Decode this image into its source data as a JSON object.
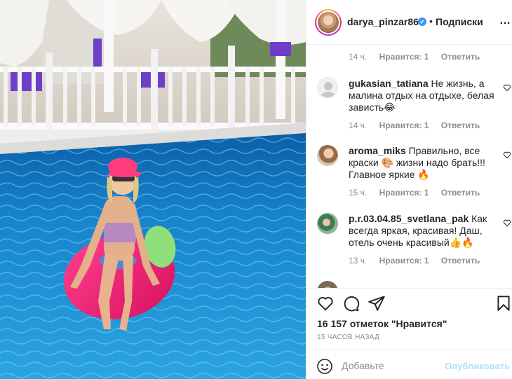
{
  "post": {
    "username": "darya_pinzar86",
    "verified_mark": "✔",
    "separator": "•",
    "follow_label": "Подписки",
    "more_icon": "…"
  },
  "comments": [
    {
      "time": "14 ч.",
      "likes": "Нравится: 1",
      "reply": "Ответить"
    },
    {
      "user": "gukasian_tatiana",
      "text": " Не жизнь, а малина отдых на отдыхе, белая зависть😂",
      "time": "14 ч.",
      "likes": "Нравится: 1",
      "reply": "Ответить"
    },
    {
      "user": "aroma_miks",
      "text": " Правильно, все краски 🎨 жизни надо брать!!! Главное яркие 🔥",
      "time": "15 ч.",
      "likes": "Нравится: 1",
      "reply": "Ответить"
    },
    {
      "user": "p.r.03.04.85_svetlana_pak",
      "text": " Как всегда яркая, красивая! Даш, отель очень красивый👍🔥",
      "time": "13 ч.",
      "likes": "Нравится: 1",
      "reply": "Ответить"
    }
  ],
  "likes_count": "16 157 отметок \"Нравится\"",
  "posted_ago": "15 ЧАСОВ НАЗАД",
  "add_comment": {
    "placeholder": "Добавьте",
    "post_label": "Опубликовать"
  },
  "icons": {
    "like": "heart-icon",
    "comment": "comment-icon",
    "share": "send-icon",
    "save": "bookmark-icon",
    "emoji": "smiley-icon"
  },
  "colors": {
    "link": "#b2dffc",
    "verified": "#3897f0",
    "muted": "#8e8e8e"
  }
}
